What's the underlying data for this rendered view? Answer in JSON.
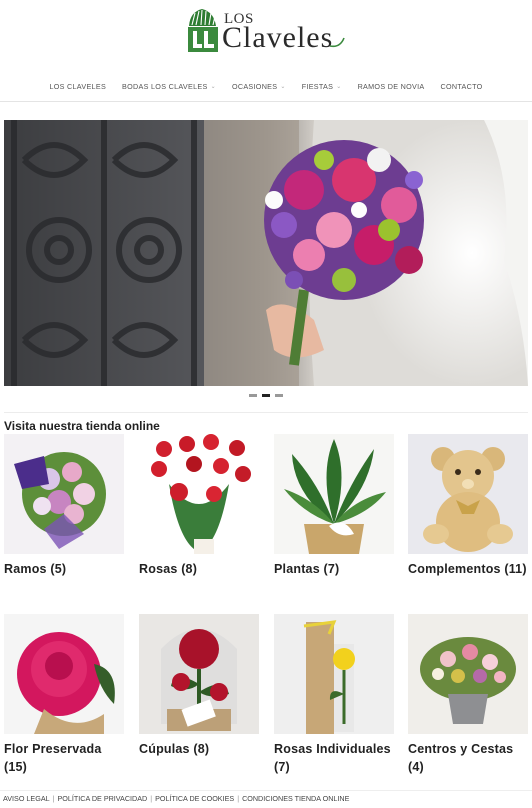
{
  "brand": {
    "logo_top": "LOS",
    "logo_main": "Claveles",
    "colors": {
      "green": "#3b8a3e",
      "text": "#2b2b2b"
    }
  },
  "nav": {
    "items": [
      {
        "label": "LOS CLAVELES",
        "has_dropdown": false
      },
      {
        "label": "BODAS LOS CLAVELES",
        "has_dropdown": true
      },
      {
        "label": "OCASIONES",
        "has_dropdown": true
      },
      {
        "label": "FIESTAS",
        "has_dropdown": true
      },
      {
        "label": "RAMOS DE NOVIA",
        "has_dropdown": false
      },
      {
        "label": "CONTACTO",
        "has_dropdown": false
      }
    ],
    "caret": "⌄"
  },
  "slider": {
    "slides": 3,
    "active_index": 1
  },
  "shop": {
    "title": "Visita nuestra tienda online",
    "products": [
      {
        "label": "Ramos (5)"
      },
      {
        "label": "Rosas (8)"
      },
      {
        "label": "Plantas (7)"
      },
      {
        "label": "Complementos (11)"
      },
      {
        "label": "Flor Preservada (15)"
      },
      {
        "label": "Cúpulas (8)"
      },
      {
        "label": "Rosas Individuales (7)"
      },
      {
        "label": "Centros y Cestas (4)"
      }
    ]
  },
  "footer": {
    "links": [
      {
        "label": "AVISO LEGAL"
      },
      {
        "label": "POLÍTICA DE PRIVACIDAD"
      },
      {
        "label": "POLÍTICA DE COOKIES"
      },
      {
        "label": "CONDICIONES TIENDA ONLINE"
      }
    ]
  }
}
